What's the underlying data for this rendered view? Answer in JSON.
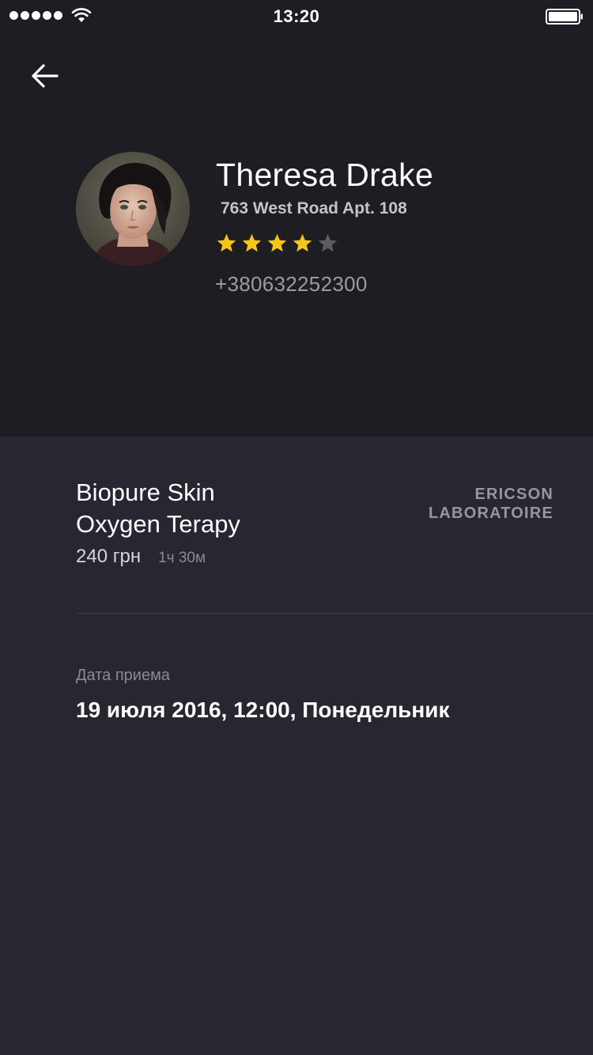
{
  "status_bar": {
    "time": "13:20",
    "signal_icon": "signal-dots-icon",
    "wifi_icon": "wifi-icon",
    "battery_icon": "battery-icon"
  },
  "nav": {
    "back_icon": "arrow-left-icon"
  },
  "profile": {
    "name": "Theresa Drake",
    "address": "763 West Road Apt. 108",
    "rating": 4,
    "rating_max": 5,
    "phone": "+380632252300"
  },
  "service": {
    "title_line1": "Biopure Skin",
    "title_line2": "Oxygen Terapy",
    "vendor_line1": "ERICSON",
    "vendor_line2": "LABORATOIRE",
    "price": "240 грн",
    "duration": "1ч 30м"
  },
  "appointment": {
    "label": "Дата приема",
    "value": "19 июля 2016, 12:00, Понедельник"
  },
  "colors": {
    "header_bg": "#1d1d23",
    "body_bg": "#272731",
    "star_filled": "#f5c518",
    "star_empty": "#5c5c63"
  }
}
